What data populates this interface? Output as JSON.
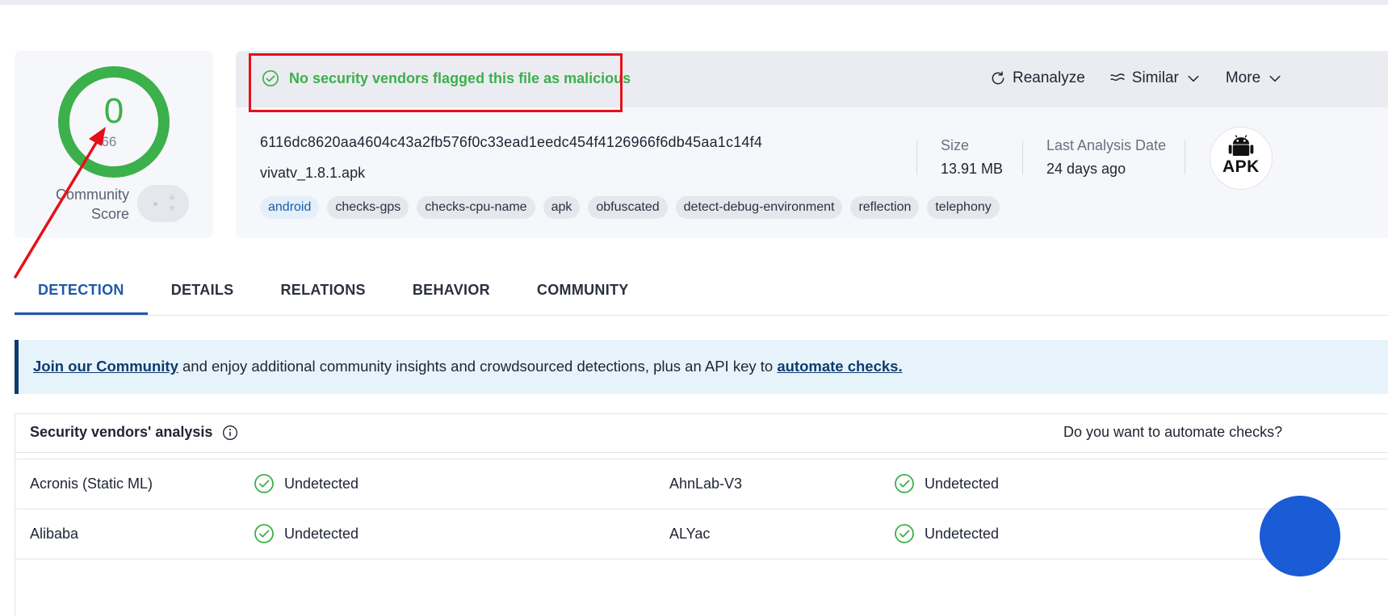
{
  "score": {
    "value": "0",
    "total": "/ 66",
    "label_line1": "Community",
    "label_line2": "Score"
  },
  "verdict": {
    "text": "No security vendors flagged this file as malicious"
  },
  "actions": {
    "reanalyze": "Reanalyze",
    "similar": "Similar",
    "more": "More"
  },
  "file": {
    "hash": "6116dc8620aa4604c43a2fb576f0c33ead1eedc454f4126966f6db45aa1c14f4",
    "name": "vivatv_1.8.1.apk",
    "tags": [
      "android",
      "checks-gps",
      "checks-cpu-name",
      "apk",
      "obfuscated",
      "detect-debug-environment",
      "reflection",
      "telephony"
    ]
  },
  "meta": {
    "size_label": "Size",
    "size_value": "13.91 MB",
    "date_label": "Last Analysis Date",
    "date_value": "24 days ago",
    "filetype_badge": "APK"
  },
  "tabs": [
    "DETECTION",
    "DETAILS",
    "RELATIONS",
    "BEHAVIOR",
    "COMMUNITY"
  ],
  "banner": {
    "link1": "Join our Community",
    "middle": " and enjoy additional community insights and crowdsourced detections, plus an API key to ",
    "link2": "automate checks."
  },
  "vendors": {
    "title": "Security vendors' analysis",
    "automate_prompt": "Do you want to automate checks?",
    "rows": [
      {
        "left_vendor": "Acronis (Static ML)",
        "left_status": "Undetected",
        "right_vendor": "AhnLab-V3",
        "right_status": "Undetected"
      },
      {
        "left_vendor": "Alibaba",
        "left_status": "Undetected",
        "right_vendor": "ALYac",
        "right_status": "Undetected"
      }
    ]
  },
  "colors": {
    "clean_green": "#3cb04a",
    "accent_blue": "#1d5aa8",
    "annotation_red": "#e5101a"
  }
}
